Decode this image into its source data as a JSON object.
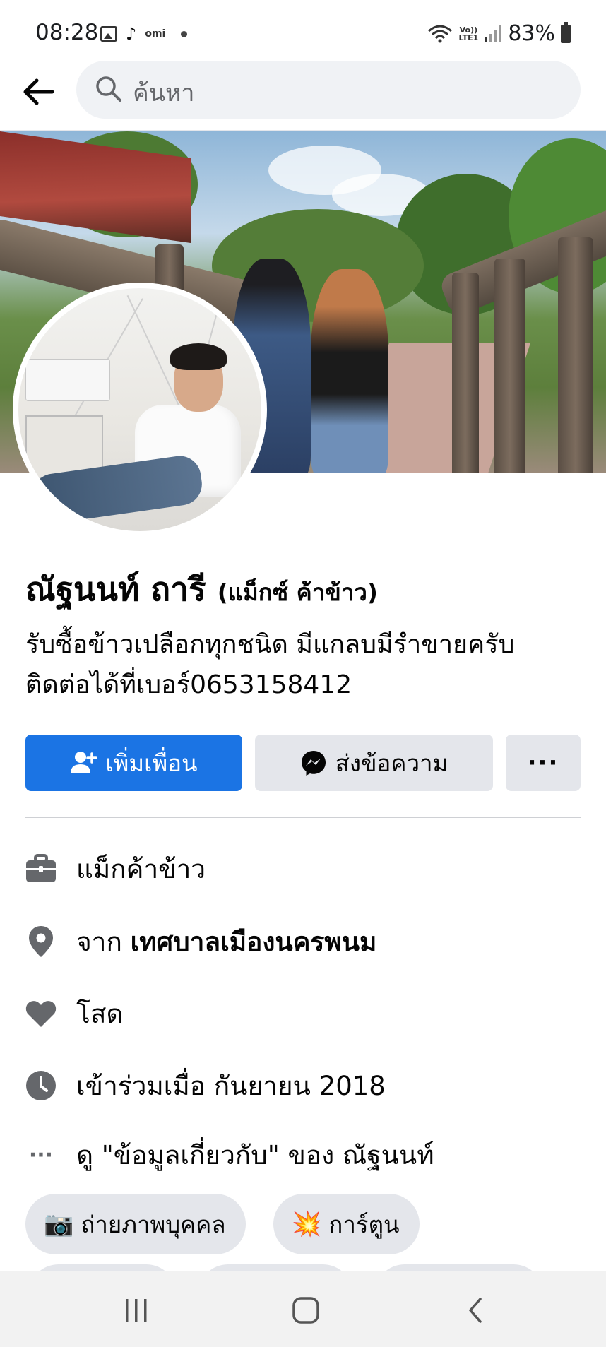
{
  "status_bar": {
    "time": "08:28",
    "left_icons": [
      "gallery-icon",
      "tiktok-icon",
      "omi-icon",
      "notification-dot-icon"
    ],
    "omi_label": "omi",
    "volte_label_top": "Vo))",
    "volte_label_bottom": "LTE1",
    "battery_text": "83%"
  },
  "topbar": {
    "search_placeholder": "ค้นหา"
  },
  "profile": {
    "name": "ณัฐนนท์ ถารี",
    "alt_name": "(แม็กซ์ ค้าข้าว)",
    "bio_line1": "รับซื้อข้าวเปลือกทุกชนิด มีแกลบมีรำขายครับ",
    "bio_line2": "ติดต่อได้ที่เบอร์0653158412"
  },
  "actions": {
    "add_friend_label": "เพิ่มเพื่อน",
    "message_label": "ส่งข้อความ",
    "more_label": "···"
  },
  "details": {
    "work": "แม็กค้าข้าว",
    "from_prefix": "จาก",
    "from_place": "เทศบาลเมืองนครพนม",
    "relationship": "โสด",
    "joined": "เข้าร่วมเมื่อ กันยายน  2018",
    "about_more_icon": "···",
    "about_link": "ดู \"ข้อมูลเกี่ยวกับ\" ของ ณัฐนนท์"
  },
  "interests": [
    {
      "emoji": "📷",
      "label": "ถ่ายภาพบุคคล"
    },
    {
      "emoji": "💥",
      "label": "การ์ตูน"
    }
  ],
  "colors": {
    "primary_blue": "#1b74e4",
    "button_gray": "#e4e6eb",
    "search_bg": "#f0f2f5",
    "icon_gray": "#65676b",
    "text": "#050505"
  }
}
